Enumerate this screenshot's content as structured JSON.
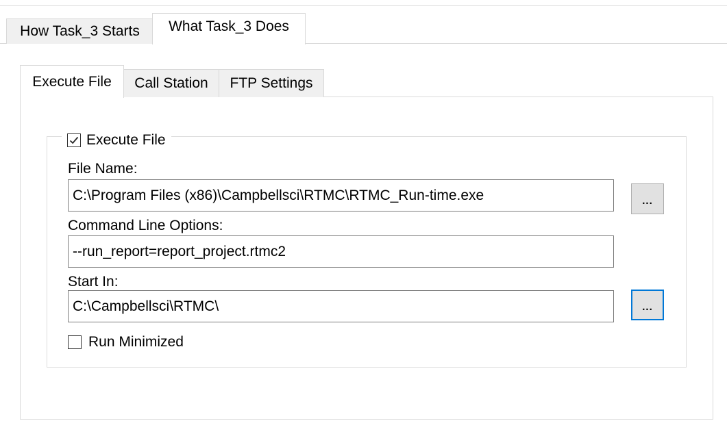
{
  "outer_tabs": [
    {
      "label": "How Task_3 Starts",
      "active": false
    },
    {
      "label": "What Task_3 Does",
      "active": true
    }
  ],
  "inner_tabs": [
    {
      "label": "Execute File",
      "active": true
    },
    {
      "label": "Call Station",
      "active": false
    },
    {
      "label": "FTP Settings",
      "active": false
    }
  ],
  "execute_group": {
    "checkbox_label": "Execute File",
    "checked": true
  },
  "file_name": {
    "label": "File Name:",
    "value": "C:\\Program Files (x86)\\Campbellsci\\RTMC\\RTMC_Run-time.exe",
    "browse_label": "..."
  },
  "command_line": {
    "label": "Command Line Options:",
    "value": "--run_report=report_project.rtmc2"
  },
  "start_in": {
    "label": "Start In:",
    "value": "C:\\Campbellsci\\RTMC\\",
    "browse_label": "..."
  },
  "run_minimized": {
    "label": "Run Minimized",
    "checked": false
  },
  "colors": {
    "focus_border": "#0078d7",
    "tab_inactive_bg": "#f0f0f0",
    "button_bg": "#e1e1e1"
  }
}
